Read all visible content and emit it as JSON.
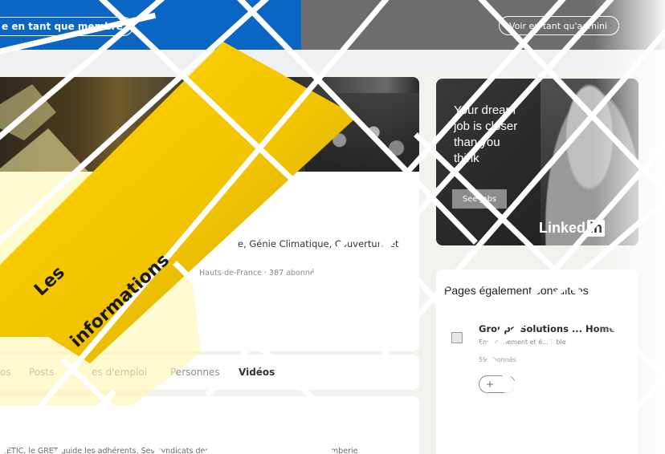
{
  "header": {
    "member_view_label": "e en tant que membre",
    "admin_view_label": "Voir en tant qu'admini"
  },
  "profile": {
    "description": "e, Génie Climatique, Couverture et",
    "meta": "Hauts-de-France · 387 abonnés",
    "visit_icon": "external-link-icon"
  },
  "tabs": [
    {
      "label": "os"
    },
    {
      "label": "Posts"
    },
    {
      "label": "es d'emploi"
    },
    {
      "label": "Personnes"
    },
    {
      "label": "Vidéos"
    }
  ],
  "about": {
    "text": "2ETIC, le GRET guide les adhérents. Ses syndicats der",
    "text_tail": "mberie"
  },
  "ad": {
    "headline": [
      "Your dream",
      "job is closer",
      "than you",
      "think"
    ],
    "cta": "See jobs",
    "brand_text": "Linked",
    "brand_in": "in"
  },
  "also_viewed": {
    "title": "Pages également consultées",
    "items": [
      {
        "name": "Groupe Solutions ... Home",
        "sector": "Environnement et é... lable",
        "followers": "59 abonnés",
        "follow_label": "+"
      }
    ]
  },
  "banner": {
    "line1": "Les",
    "line2": "informations",
    "color": "#f5c400"
  }
}
